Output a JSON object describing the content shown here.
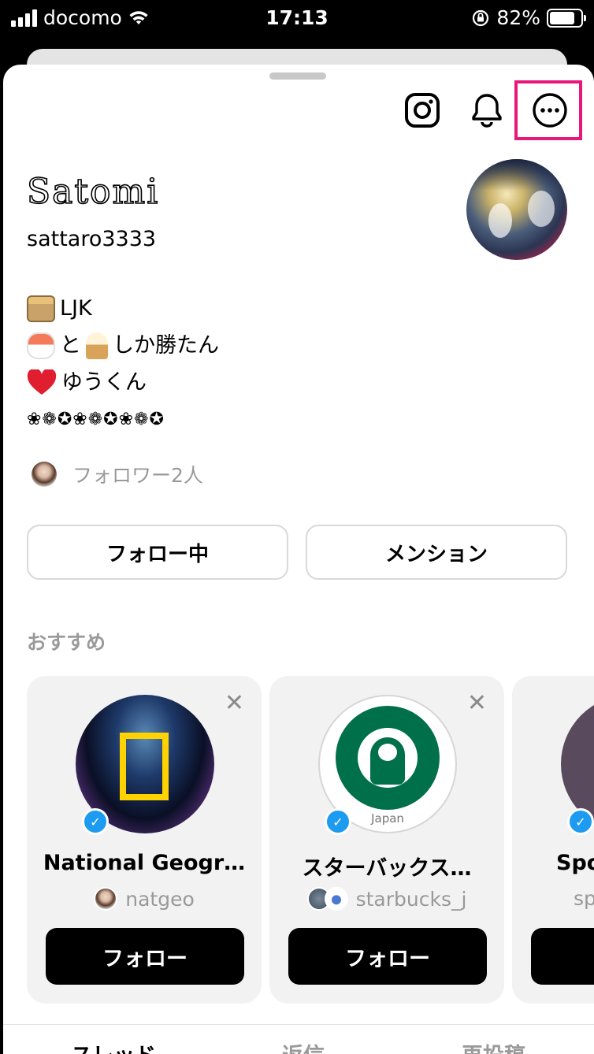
{
  "status_bar": {
    "carrier": "docomo",
    "time": "17:13",
    "battery": "82%",
    "battery_level": 0.82
  },
  "header": {
    "icons": [
      "instagram-icon",
      "bell-icon",
      "more-icon"
    ]
  },
  "profile": {
    "display_name": "Satomi",
    "username": "sattaro3333",
    "bio": {
      "line1_text": "LJK",
      "line2_a": "と",
      "line2_b": "しか勝たん",
      "line3_text": "ゆうくん",
      "line4_text": "❀❁✪❀❁✪❀❁✪"
    },
    "followers_text": "フォロワー2人"
  },
  "actions": {
    "following_label": "フォロー中",
    "mention_label": "メンション"
  },
  "recommendations": {
    "title": "おすすめ",
    "cards": [
      {
        "name": "National Geogr…",
        "handle": "natgeo",
        "follow_label": "フォロー",
        "close": "✕"
      },
      {
        "name": "スターバックス…",
        "handle": "starbucks_j",
        "follow_label": "フォロー",
        "close": "✕",
        "logo_caption": "Japan"
      },
      {
        "name": "Spo",
        "handle": "sp",
        "follow_label": "フ",
        "close": "✕"
      }
    ]
  },
  "tabs": [
    "スレッド",
    "返信",
    "再投稿"
  ],
  "colors": {
    "highlight": "#e8177a",
    "verified": "#1d9bf0",
    "starbucks_green": "#00704a",
    "natgeo_yellow": "#ffd200"
  }
}
